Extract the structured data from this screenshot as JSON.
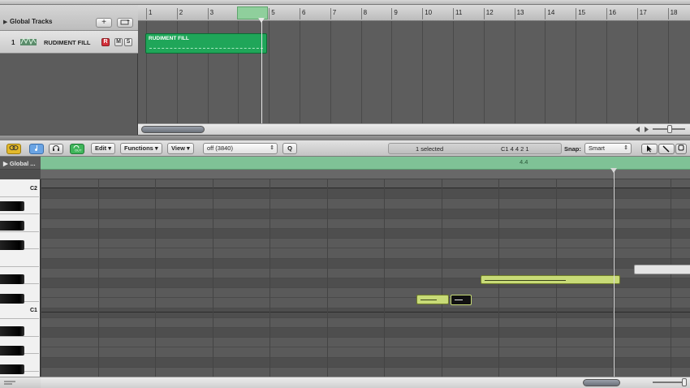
{
  "arrange": {
    "global_tracks_label": "Global Tracks",
    "add_track_label": "+",
    "track": {
      "number": "1",
      "name": "RUDIMENT FILL",
      "record": "R",
      "mute": "M",
      "solo": "S"
    },
    "ruler_bars": [
      "1",
      "2",
      "3",
      "4",
      "5",
      "6",
      "7",
      "8",
      "9",
      "10",
      "11",
      "12",
      "13",
      "14",
      "15",
      "16",
      "17",
      "18"
    ],
    "region": {
      "name": "RUDIMENT FILL"
    }
  },
  "piano_roll": {
    "toolbar": {
      "edit_menu": "Edit",
      "functions_menu": "Functions",
      "view_menu": "View",
      "quantize_value": "off (3840)",
      "q_button": "Q",
      "selection_status": "1 selected",
      "note_info": "C1   4 4 2 1",
      "snap_label": "Snap:",
      "snap_value": "Smart"
    },
    "global_label": "Global ...",
    "time_signature": "4.4",
    "key_labels": {
      "c2": "C2",
      "c1": "C1"
    }
  },
  "colors": {
    "region_green": "#1fa659",
    "note_yellow": "#c8db77",
    "record_red": "#d3303a",
    "signature_green": "#7fc296"
  }
}
